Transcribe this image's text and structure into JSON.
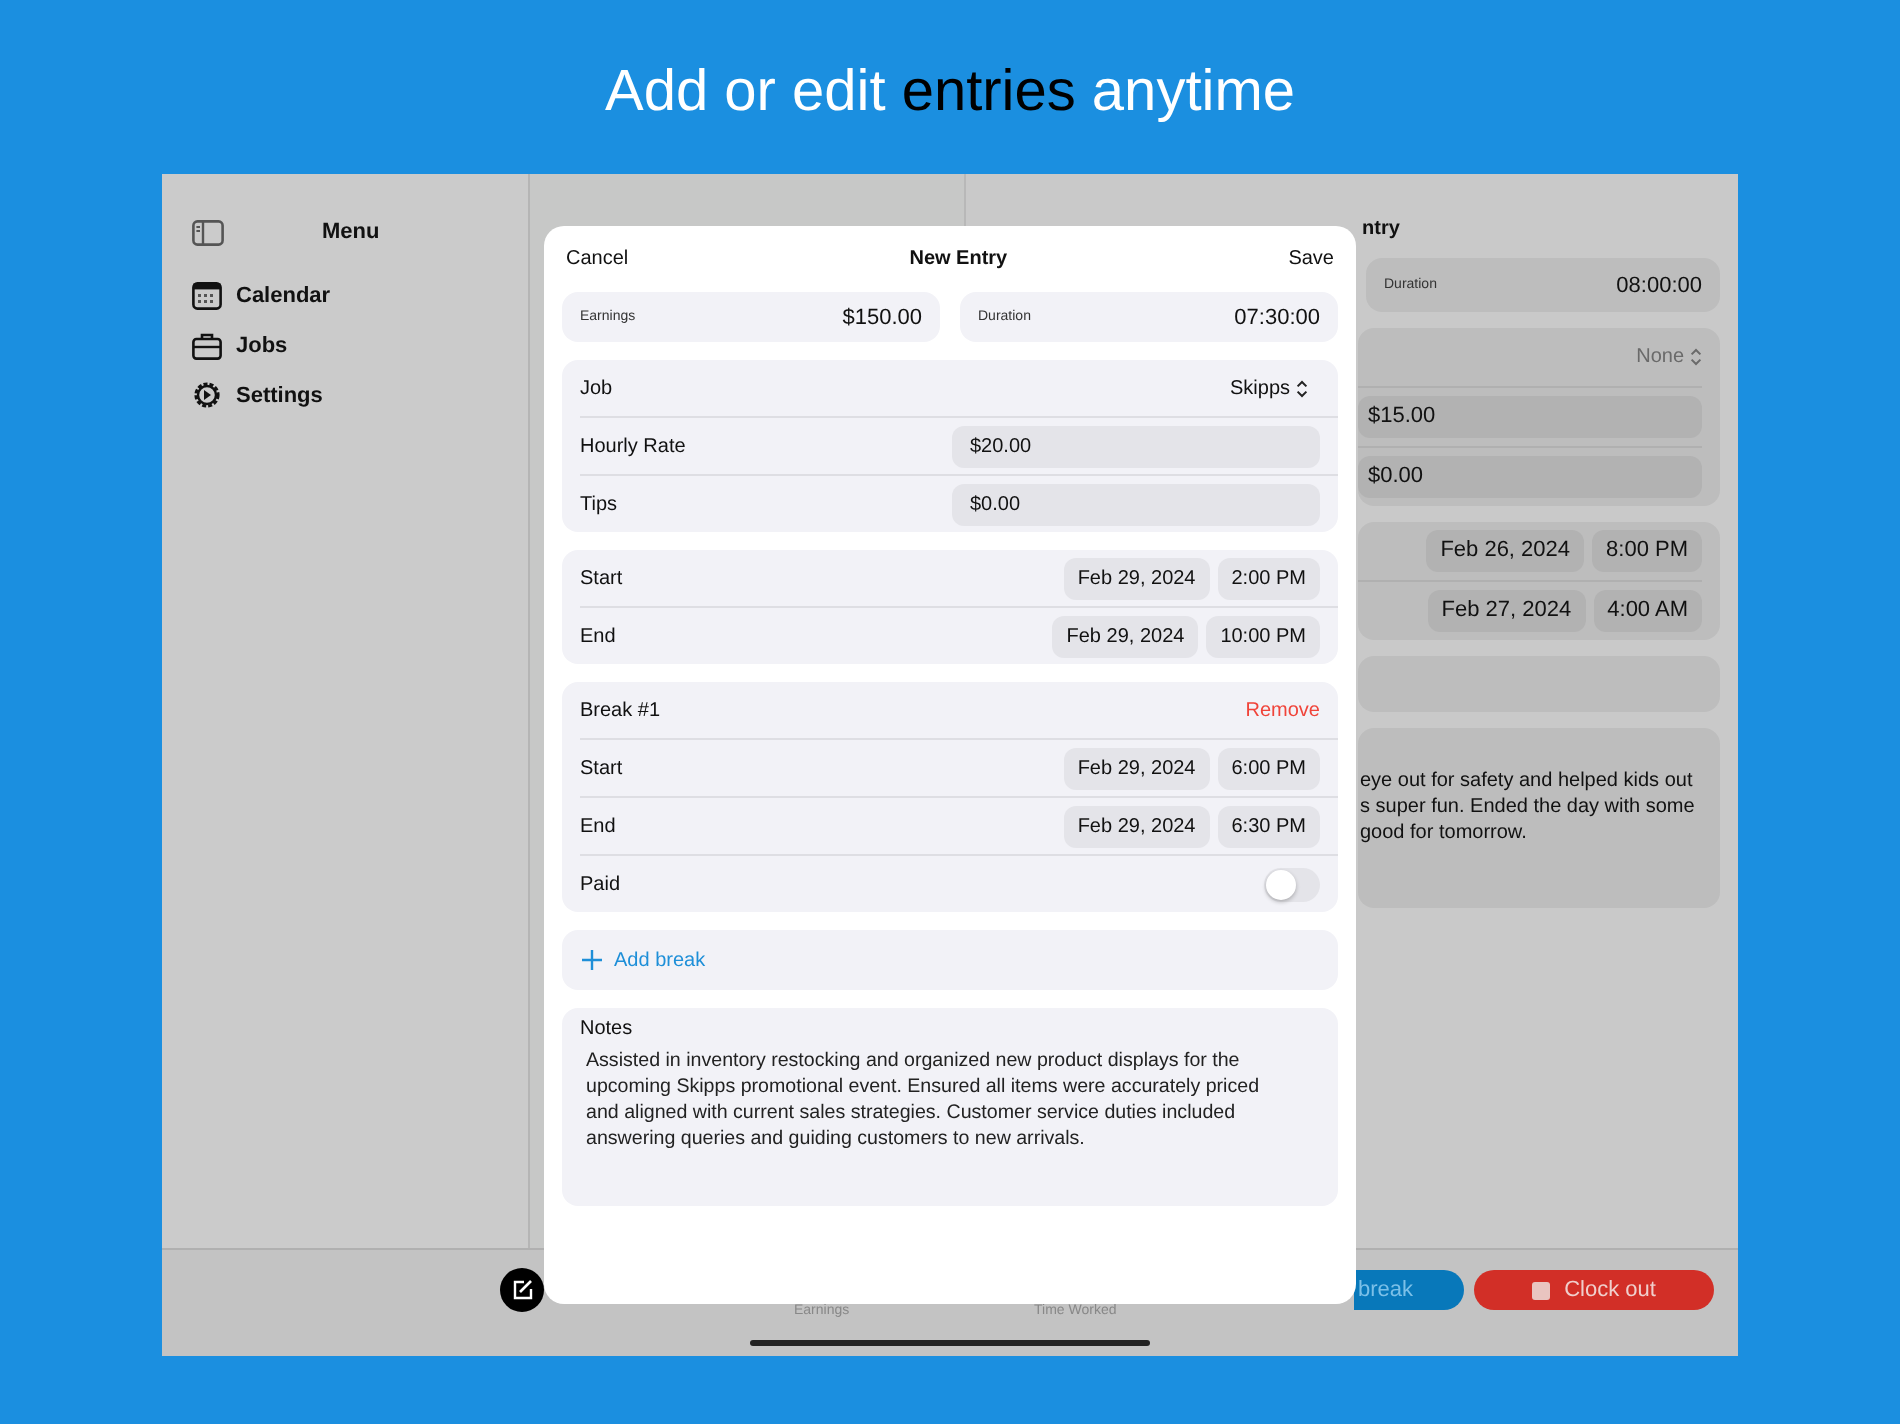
{
  "headline": "Add or edit **entries** anytime",
  "sidebar": {
    "title": "Menu",
    "items": [
      {
        "label": "Calendar",
        "kind": "calendar",
        "selected": false
      },
      {
        "label": "Jobs",
        "kind": "jobs",
        "selected": false
      },
      {
        "label": "Settings",
        "kind": "settings",
        "selected": false
      }
    ]
  },
  "detail": {
    "title_fragment": "ntry",
    "duration_label": "Duration",
    "duration": "08:00:00",
    "job": "None",
    "fields": [
      "$15.00",
      "$0.00"
    ],
    "times": [
      {
        "date": "Feb 26, 2024",
        "time": "8:00 PM"
      },
      {
        "date": "Feb 27, 2024",
        "time": "4:00 AM"
      }
    ],
    "notes_lines": [
      "eye out for safety and helped kids out",
      "s super fun. Ended the day with some",
      "good for tomorrow."
    ]
  },
  "bottom_bar": {
    "labels": [
      "Earnings",
      "Time Worked"
    ],
    "break_button": "break",
    "clock_out": "Clock out"
  },
  "modal": {
    "cancel": "Cancel",
    "title": "New Entry",
    "save": "Save",
    "stats": [
      {
        "label": "Earnings",
        "value": "$150.00"
      },
      {
        "label": "Duration",
        "value": "07:30:00"
      }
    ],
    "job": {
      "label": "Job",
      "value": "Skipps"
    },
    "fields": [
      {
        "label": "Hourly Rate",
        "value": "$20.00"
      },
      {
        "label": "Tips",
        "value": "$0.00"
      }
    ],
    "times": [
      {
        "label": "Start",
        "date": "Feb 29, 2024",
        "time": "2:00 PM"
      },
      {
        "label": "End",
        "date": "Feb 29, 2024",
        "time": "10:00 PM"
      }
    ],
    "breaks": [
      {
        "title": "Break #1",
        "remove": "Remove",
        "paid_label": "Paid",
        "paid": false,
        "times": [
          {
            "label": "Start",
            "date": "Feb 29, 2024",
            "time": "6:00 PM"
          },
          {
            "label": "End",
            "date": "Feb 29, 2024",
            "time": "6:30 PM"
          }
        ]
      }
    ],
    "add_break": "Add break",
    "notes_label": "Notes",
    "notes": "Assisted in inventory restocking and organized new product displays for the upcoming Skipps promotional event. Ensured all items were accurately priced and aligned with current sales strategies. Customer service duties included answering queries and guiding customers to new arrivals."
  }
}
